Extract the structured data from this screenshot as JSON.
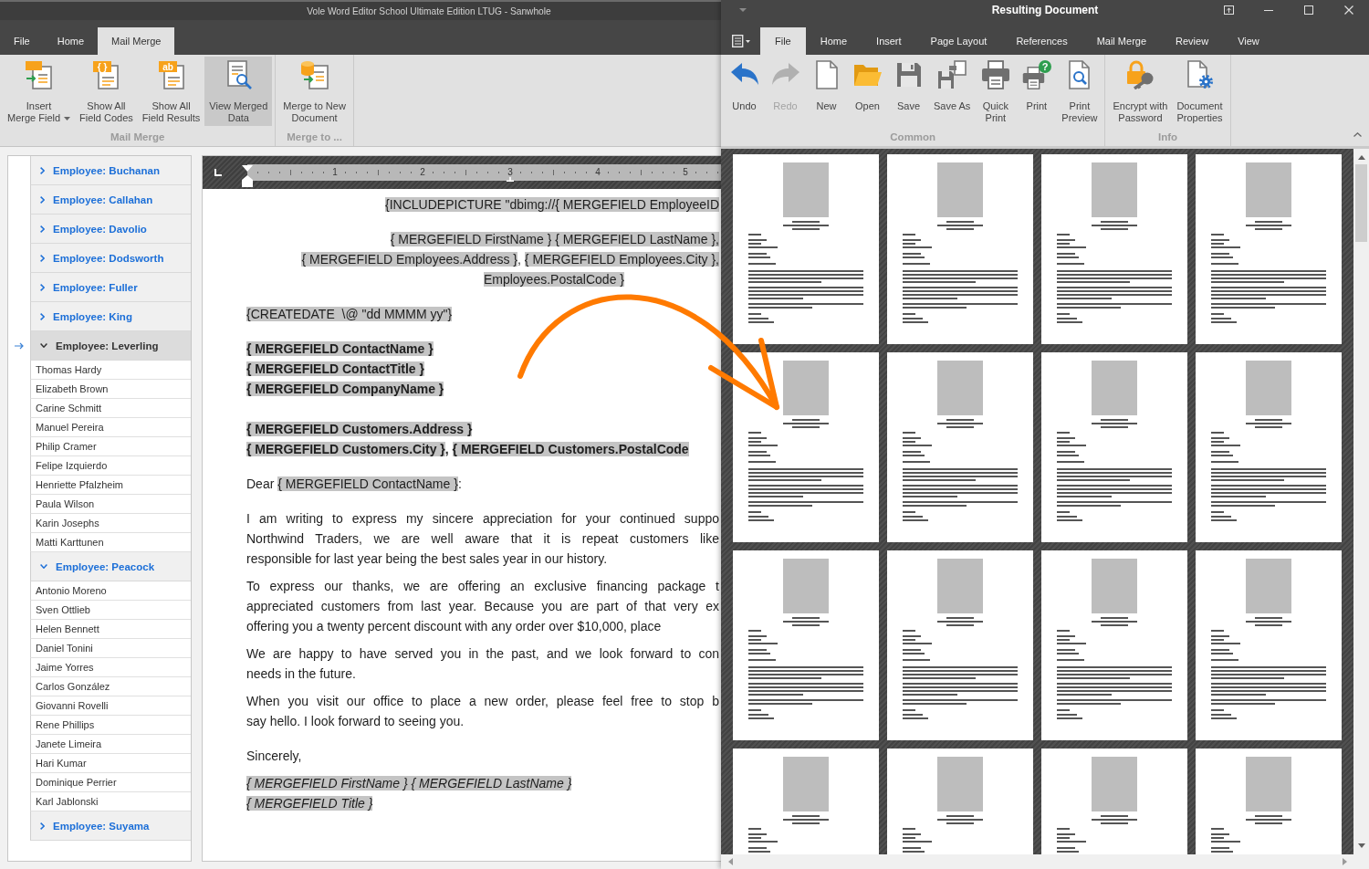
{
  "editor": {
    "title": "Vole Word Editor School Ultimate Edition LTUG - Sanwhole",
    "tabs": [
      {
        "label": "File",
        "selected": false
      },
      {
        "label": "Home",
        "selected": false
      },
      {
        "label": "Mail Merge",
        "selected": true
      }
    ],
    "ribbon_groups": [
      {
        "label": "Mail Merge",
        "buttons": [
          {
            "kind": "insert-field",
            "label": "Insert\nMerge Field",
            "dropdown": true,
            "selected": false
          },
          {
            "kind": "field-codes",
            "label": "Show All\nField Codes",
            "badge": "{ }",
            "selected": false
          },
          {
            "kind": "field-results",
            "label": "Show All\nField Results",
            "badge": "ab",
            "selected": false
          },
          {
            "kind": "view-merged",
            "label": "View Merged\nData",
            "selected": true
          }
        ]
      },
      {
        "label": "Merge to ...",
        "buttons": [
          {
            "kind": "merge-new",
            "label": "Merge to New\nDocument",
            "selected": false
          }
        ]
      }
    ],
    "records": [
      {
        "label": "Employee: Buchanan",
        "expanded": false,
        "selected": false
      },
      {
        "label": "Employee: Callahan",
        "expanded": false,
        "selected": false
      },
      {
        "label": "Employee: Davolio",
        "expanded": false,
        "selected": false
      },
      {
        "label": "Employee: Dodsworth",
        "expanded": false,
        "selected": false
      },
      {
        "label": "Employee: Fuller",
        "expanded": false,
        "selected": false
      },
      {
        "label": "Employee: King",
        "expanded": false,
        "selected": false
      },
      {
        "label": "Employee: Leverling",
        "expanded": true,
        "selected": true,
        "children": [
          {
            "label": "Thomas Hardy",
            "selected": false
          },
          {
            "label": "Elizabeth Brown",
            "selected": false
          },
          {
            "label": "Carine Schmitt",
            "selected": false
          },
          {
            "label": "Manuel Pereira",
            "selected": false
          },
          {
            "label": "Philip Cramer",
            "selected": false
          },
          {
            "label": "Felipe Izquierdo",
            "selected": false
          },
          {
            "label": "Henriette Pfalzheim",
            "selected": false
          },
          {
            "label": "Paula Wilson",
            "selected": false
          },
          {
            "label": "Karin Josephs",
            "selected": false
          },
          {
            "label": "Matti Karttunen",
            "selected": false
          }
        ]
      },
      {
        "label": "Employee: Peacock",
        "expanded": true,
        "selected": false,
        "children": [
          {
            "label": "Antonio Moreno",
            "selected": false
          },
          {
            "label": "Sven Ottlieb",
            "selected": false
          },
          {
            "label": "Helen Bennett",
            "selected": false
          },
          {
            "label": "Daniel Tonini",
            "selected": false
          },
          {
            "label": "Jaime Yorres",
            "selected": false
          },
          {
            "label": "Carlos González",
            "selected": false
          },
          {
            "label": "Giovanni Rovelli",
            "selected": false
          },
          {
            "label": "Rene Phillips",
            "selected": false
          },
          {
            "label": "Janete Limeira",
            "selected": false
          },
          {
            "label": "Hari Kumar",
            "selected": false
          },
          {
            "label": "Dominique Perrier",
            "selected": false
          },
          {
            "label": "Karl Jablonski",
            "selected": false
          }
        ]
      },
      {
        "label": "Employee: Suyama",
        "expanded": false,
        "selected": false
      }
    ],
    "ruler": [
      "1",
      "2",
      "3",
      "4",
      "5"
    ],
    "document": [
      {
        "kind": "centered",
        "lines": [
          [
            {
              "kind": "field",
              "text": "{INCLUDEPICTURE \"dbimg://{ MERGEFIELD EmployeeID"
            }
          ]
        ]
      },
      {
        "kind": "centered",
        "lines": [
          [
            {
              "kind": "field",
              "text": "{ MERGEFIELD FirstName }"
            },
            {
              "kind": "field",
              "text": " { MERGEFIELD LastName },"
            }
          ],
          [
            {
              "kind": "field",
              "text": "{ MERGEFIELD Employees.Address }"
            },
            {
              "kind": "text",
              "text": ", "
            },
            {
              "kind": "field",
              "text": "{ MERGEFIELD Employees.City },"
            }
          ],
          [
            {
              "kind": "field",
              "text": "Employees.PostalCode }"
            }
          ]
        ]
      },
      {
        "kind": "fields",
        "lines": [
          [
            {
              "kind": "field",
              "text": "{CREATEDATE  \\@ \"dd MMMM yy\"}"
            }
          ]
        ]
      },
      {
        "kind": "bold",
        "lines": [
          [
            {
              "kind": "field",
              "text": "{ MERGEFIELD ContactName }"
            }
          ],
          [
            {
              "kind": "field",
              "text": "{ MERGEFIELD ContactTitle }"
            }
          ],
          [
            {
              "kind": "field",
              "text": "{ MERGEFIELD CompanyName }"
            }
          ]
        ]
      },
      {
        "kind": "bold",
        "lines": [
          [
            {
              "kind": "field",
              "text": "{ MERGEFIELD Customers.Address }"
            }
          ],
          [
            {
              "kind": "field",
              "text": "{ MERGEFIELD Customers.City }"
            },
            {
              "kind": "text",
              "text": ", "
            },
            {
              "kind": "field",
              "text": "{ MERGEFIELD Customers.PostalCode"
            }
          ]
        ]
      },
      {
        "kind": "fields",
        "lines": [
          [
            {
              "kind": "text",
              "text": "Dear "
            },
            {
              "kind": "field",
              "text": "{ MERGEFIELD ContactName }"
            },
            {
              "kind": "text",
              "text": ":"
            }
          ]
        ]
      },
      {
        "kind": "paragraph",
        "lines": [
          "I am writing to express my sincere appreciation for your continued suppo",
          "Northwind Traders, we are well aware that it is repeat customers like",
          "responsible for last year being the best sales year in our history."
        ]
      },
      {
        "kind": "paragraph",
        "lines": [
          "To express our thanks, we are offering an exclusive financing package t",
          "appreciated customers from last year. Because you are part of that very ex",
          "offering you a twenty percent discount with any order over $10,000, place"
        ]
      },
      {
        "kind": "paragraph",
        "lines": [
          "We are happy to have served you in the past, and we look forward to con",
          "needs in the future."
        ]
      },
      {
        "kind": "paragraph",
        "lines": [
          "When you visit our office to place a new order, please feel free to stop b",
          "say hello. I look forward to seeing you."
        ]
      },
      {
        "kind": "fields",
        "lines": [
          [
            {
              "kind": "text",
              "text": "Sincerely,"
            }
          ]
        ]
      },
      {
        "kind": "italic",
        "lines": [
          [
            {
              "kind": "field",
              "text": "{ MERGEFIELD FirstName }"
            },
            {
              "kind": "field",
              "text": " { MERGEFIELD LastName }"
            }
          ],
          [
            {
              "kind": "field",
              "text": "{ MERGEFIELD Title }"
            }
          ]
        ]
      }
    ]
  },
  "result_window": {
    "title": "Resulting Document",
    "tabs": [
      {
        "label": "File",
        "selected": true
      },
      {
        "label": "Home",
        "selected": false
      },
      {
        "label": "Insert",
        "selected": false
      },
      {
        "label": "Page Layout",
        "selected": false
      },
      {
        "label": "References",
        "selected": false
      },
      {
        "label": "Mail Merge",
        "selected": false
      },
      {
        "label": "Review",
        "selected": false
      },
      {
        "label": "View",
        "selected": false
      }
    ],
    "ribbon_groups": [
      {
        "label": "Common",
        "buttons": [
          {
            "kind": "undo",
            "label": "Undo",
            "disabled": false
          },
          {
            "kind": "redo",
            "label": "Redo",
            "disabled": true
          },
          {
            "kind": "new",
            "label": "New",
            "disabled": false
          },
          {
            "kind": "open",
            "label": "Open",
            "disabled": false
          },
          {
            "kind": "save",
            "label": "Save",
            "disabled": false
          },
          {
            "kind": "save-as",
            "label": "Save As",
            "disabled": false
          },
          {
            "kind": "quick-print",
            "label": "Quick\nPrint",
            "disabled": false
          },
          {
            "kind": "print",
            "label": "Print",
            "badge": "?",
            "disabled": false
          },
          {
            "kind": "print-preview",
            "label": "Print\nPreview",
            "disabled": false
          }
        ]
      },
      {
        "label": "Info",
        "buttons": [
          {
            "kind": "encrypt",
            "label": "Encrypt with\nPassword",
            "disabled": false
          },
          {
            "kind": "properties",
            "label": "Document\nProperties",
            "disabled": false
          }
        ]
      }
    ],
    "pages": [
      {
        "kind": "letter"
      },
      {
        "kind": "letter"
      },
      {
        "kind": "letter"
      },
      {
        "kind": "letter"
      },
      {
        "kind": "letter"
      },
      {
        "kind": "letter"
      },
      {
        "kind": "letter"
      },
      {
        "kind": "letter"
      },
      {
        "kind": "letter"
      },
      {
        "kind": "letter"
      },
      {
        "kind": "letter"
      },
      {
        "kind": "letter"
      },
      {
        "kind": "letter"
      },
      {
        "kind": "letter"
      },
      {
        "kind": "letter"
      },
      {
        "kind": "letter"
      }
    ]
  }
}
